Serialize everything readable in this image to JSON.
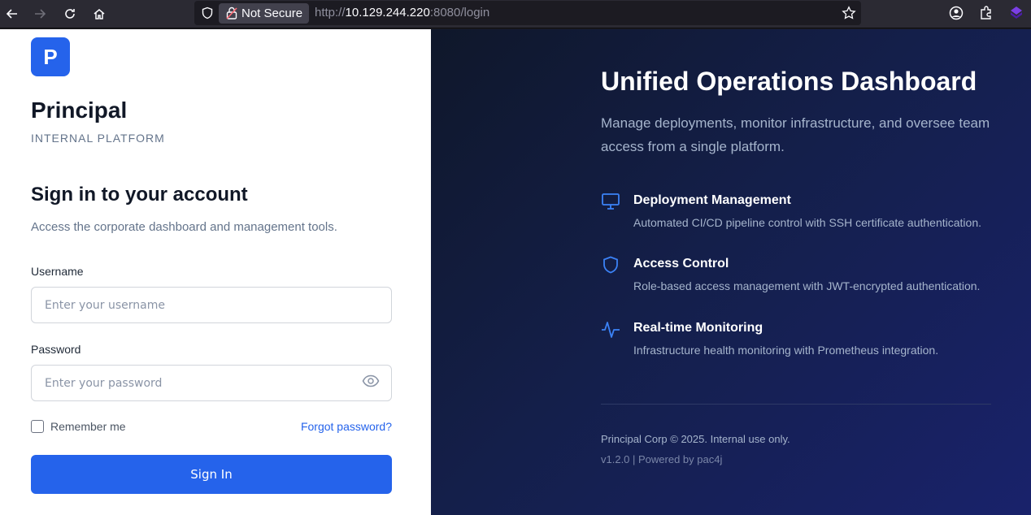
{
  "browser": {
    "security_label": "Not Secure",
    "url_scheme": "http://",
    "url_host": "10.129.244.220",
    "url_rest": ":8080/login"
  },
  "brand": {
    "logo_letter": "P",
    "name": "Principal",
    "tagline": "INTERNAL PLATFORM",
    "accent": "#2563eb"
  },
  "login": {
    "title": "Sign in to your account",
    "subtitle": "Access the corporate dashboard and management tools.",
    "username_label": "Username",
    "username_placeholder": "Enter your username",
    "password_label": "Password",
    "password_placeholder": "Enter your password",
    "remember_label": "Remember me",
    "forgot_label": "Forgot password?",
    "submit_label": "Sign In"
  },
  "hero": {
    "title": "Unified Operations Dashboard",
    "subtitle": "Manage deployments, monitor infrastructure, and oversee team access from a single platform.",
    "features": [
      {
        "icon": "monitor-icon",
        "title": "Deployment Management",
        "desc": "Automated CI/CD pipeline control with SSH certificate authentication."
      },
      {
        "icon": "shield-icon",
        "title": "Access Control",
        "desc": "Role-based access management with JWT-encrypted authentication."
      },
      {
        "icon": "activity-icon",
        "title": "Real-time Monitoring",
        "desc": "Infrastructure health monitoring with Prometheus integration."
      }
    ],
    "copyright": "Principal Corp © 2025. Internal use only.",
    "version": "v1.2.0 | Powered by pac4j"
  }
}
